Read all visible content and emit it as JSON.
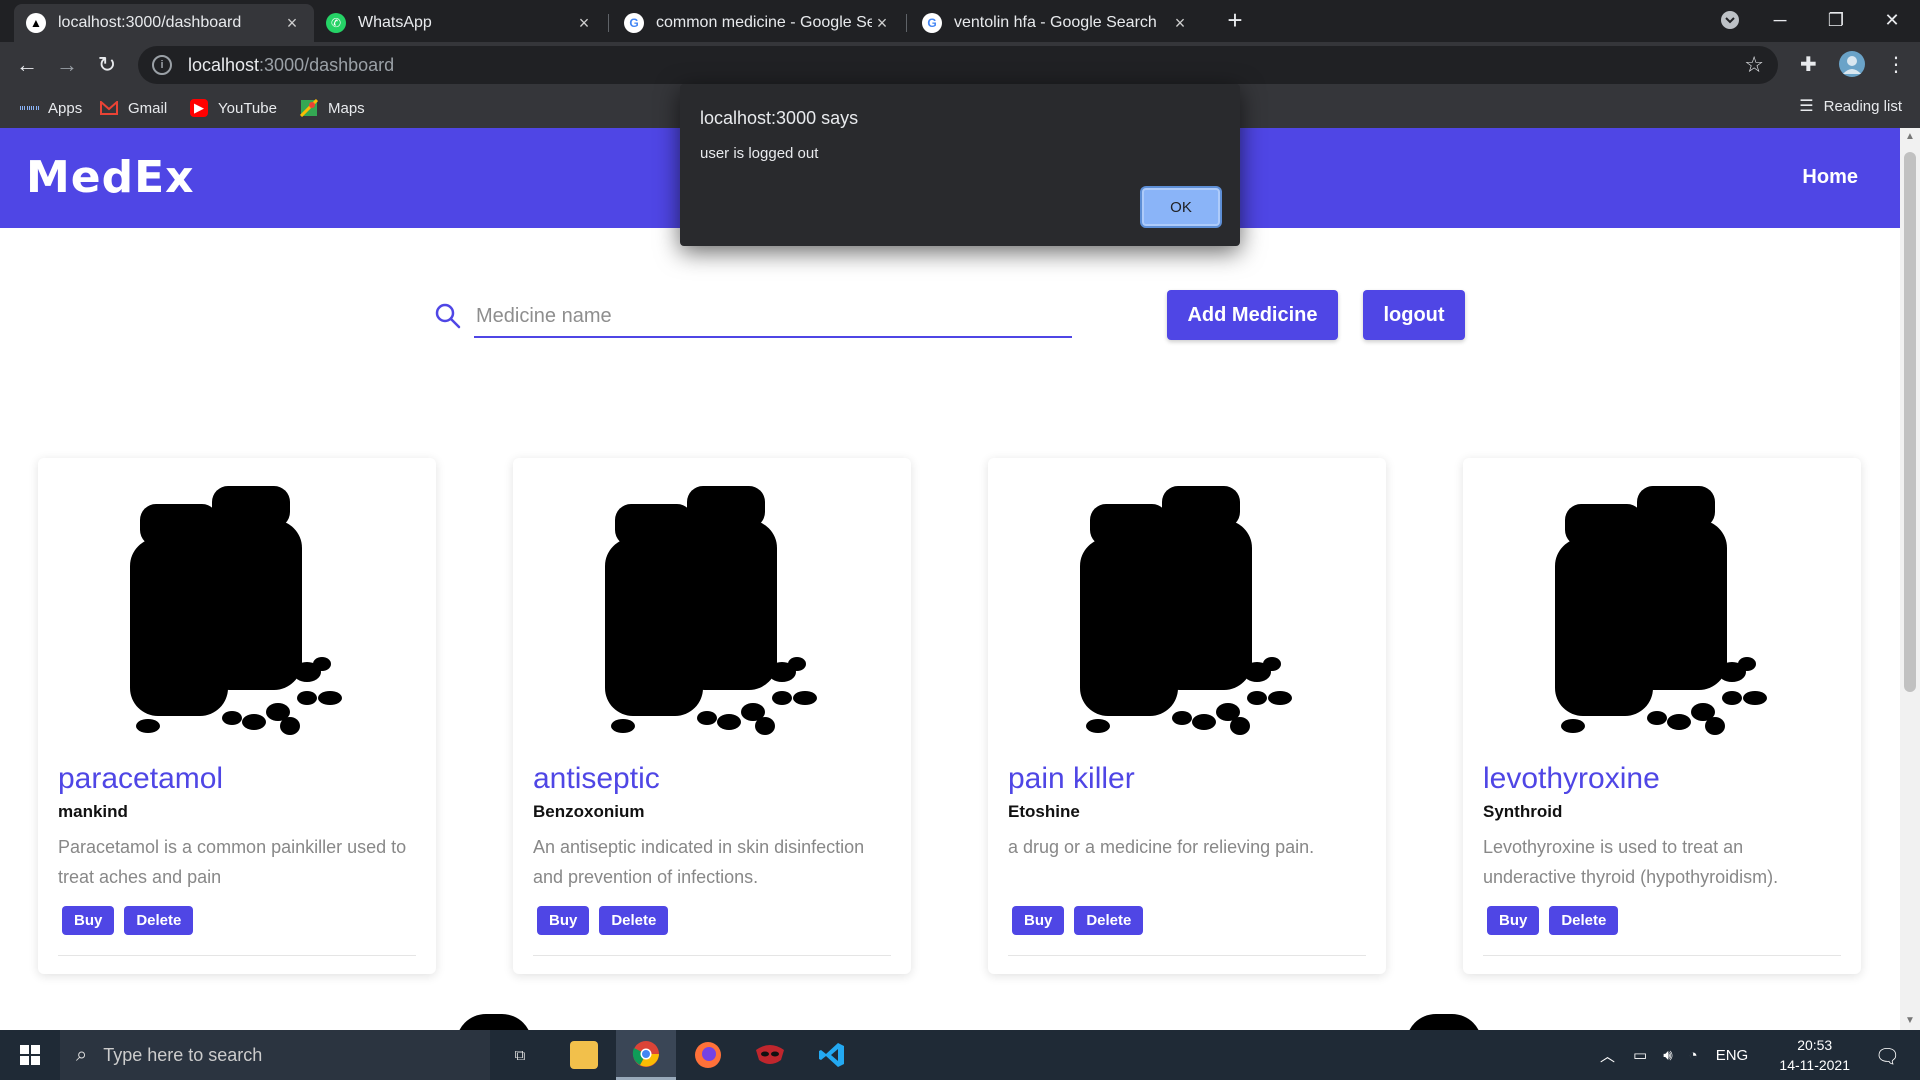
{
  "browser": {
    "tabs": [
      {
        "title": "localhost:3000/dashboard",
        "favicon": "triangle-icon",
        "active": true
      },
      {
        "title": "WhatsApp",
        "favicon": "whatsapp-icon",
        "active": false
      },
      {
        "title": "common medicine - Google Sear",
        "favicon": "google-icon",
        "active": false
      },
      {
        "title": "ventolin hfa - Google Search",
        "favicon": "google-icon",
        "active": false
      }
    ],
    "close_glyph": "×",
    "new_tab_glyph": "+",
    "url_host": "localhost",
    "url_rest": ":3000/dashboard",
    "bookmarks": [
      "Apps",
      "Gmail",
      "YouTube",
      "Maps"
    ],
    "reading_list": "Reading list"
  },
  "app": {
    "brand": "MedEx",
    "nav_home": "Home",
    "search_placeholder": "Medicine name",
    "search_value": "",
    "add_button": "Add Medicine",
    "logout_button": "logout",
    "accent_color": "#4f46e5"
  },
  "medicines": [
    {
      "name": "paracetamol",
      "brand": "mankind",
      "description": "Paracetamol is a common painkiller used to treat aches and pain"
    },
    {
      "name": "antiseptic",
      "brand": "Benzoxonium",
      "description": "An antiseptic indicated in skin disinfection and prevention of infections."
    },
    {
      "name": "pain killer",
      "brand": "Etoshine",
      "description": "a drug or a medicine for relieving pain."
    },
    {
      "name": "levothyroxine",
      "brand": "Synthroid",
      "description": "Levothyroxine is used to treat an underactive thyroid (hypothyroidism)."
    }
  ],
  "card_buttons": {
    "buy": "Buy",
    "delete": "Delete"
  },
  "dialog": {
    "title": "localhost:3000 says",
    "message": "user is logged out",
    "ok": "OK"
  },
  "taskbar": {
    "search_placeholder": "Type here to search",
    "language": "ENG",
    "time": "20:53",
    "date": "14-11-2021"
  }
}
